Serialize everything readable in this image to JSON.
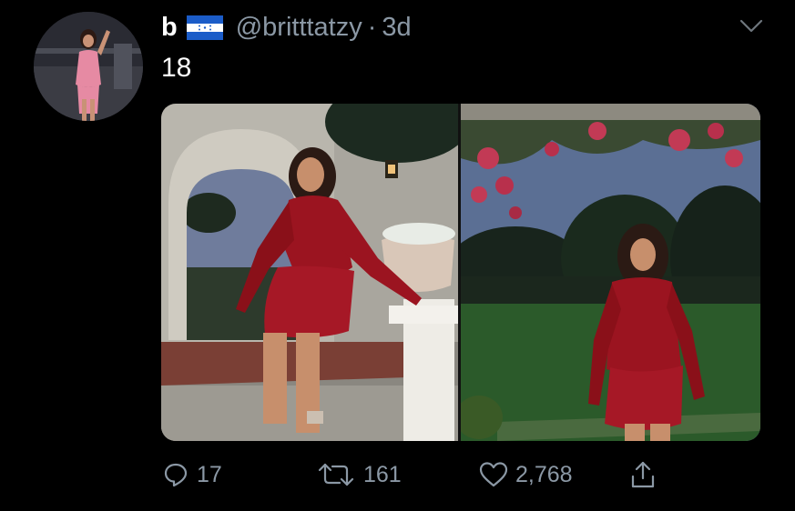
{
  "tweet": {
    "display_name": "b",
    "handle": "@britttatzy",
    "separator": "·",
    "time_ago": "3d",
    "text": "18",
    "flag_icon": "honduras-flag-icon",
    "more_icon": "chevron-down-icon"
  },
  "actions": {
    "reply_count": "17",
    "retweet_count": "161",
    "like_count": "2,768",
    "reply_icon": "reply-icon",
    "retweet_icon": "retweet-icon",
    "like_icon": "heart-icon",
    "share_icon": "share-icon"
  },
  "colors": {
    "background": "#000000",
    "secondary_text": "#8b98a5",
    "dress": "#9b1420",
    "flag_blue": "#1b5cc8"
  }
}
